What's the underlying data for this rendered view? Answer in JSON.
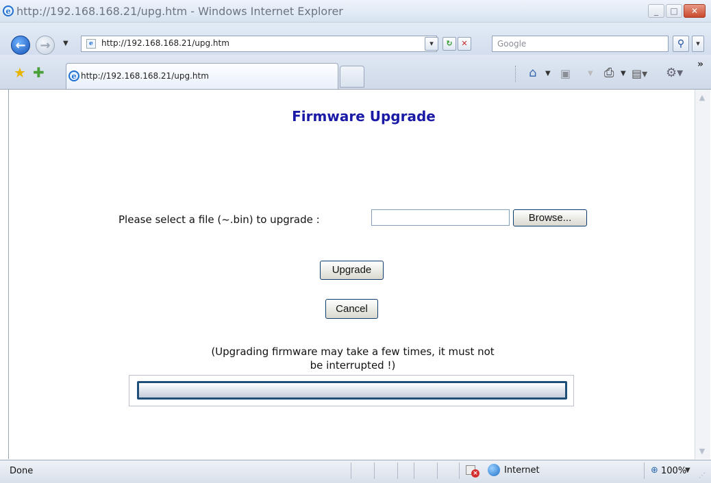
{
  "window": {
    "title": "http://192.168.168.21/upg.htm - Windows Internet Explorer",
    "minimize_icon": "minimize-icon",
    "maximize_icon": "maximize-icon",
    "close_icon": "close-icon"
  },
  "address_bar": {
    "url": "http://192.168.168.21/upg.htm",
    "search_placeholder": "Google"
  },
  "tabs": [
    {
      "label": "http://192.168.168.21/upg.htm",
      "active": true
    }
  ],
  "toolbar_icons": [
    "favorites-star-icon",
    "add-favorite-icon",
    "home-icon",
    "feeds-icon",
    "print-icon",
    "page-icon",
    "tools-icon"
  ],
  "page": {
    "title": "Firmware Upgrade",
    "file_label": "Please select a file (~.bin) to upgrade :",
    "file_value": "",
    "browse_label": "Browse...",
    "upgrade_label": "Upgrade",
    "cancel_label": "Cancel",
    "note_line1": "(Upgrading firmware may take a few times, it must not",
    "note_line2": "be interrupted !)",
    "progress": 0
  },
  "status_bar": {
    "status": "Done",
    "zone": "Internet",
    "zoom": "100%"
  },
  "colors": {
    "title": "#1a1aa6",
    "progress_border": "#1f4f78"
  }
}
